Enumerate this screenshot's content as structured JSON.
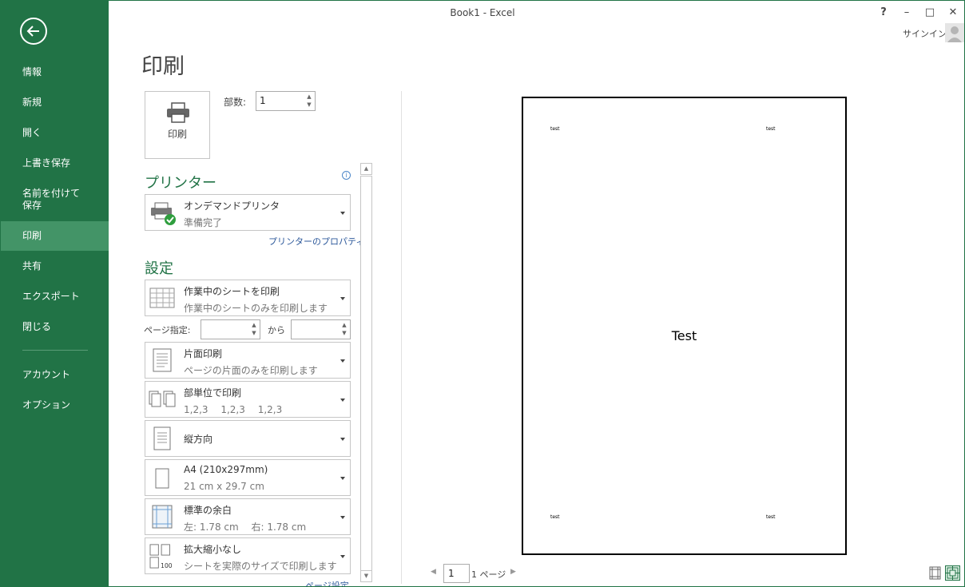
{
  "window": {
    "title": "Book1 - Excel",
    "help": "?",
    "minimize": "–",
    "maximize": "□",
    "close": "✕",
    "signin": "サインイン"
  },
  "sidebar": {
    "items": [
      {
        "label": "情報"
      },
      {
        "label": "新規"
      },
      {
        "label": "開く"
      },
      {
        "label": "上書き保存"
      },
      {
        "label": "名前を付けて保存"
      },
      {
        "label": "印刷",
        "active": true
      },
      {
        "label": "共有"
      },
      {
        "label": "エクスポート"
      },
      {
        "label": "閉じる"
      },
      {
        "label": "アカウント"
      },
      {
        "label": "オプション"
      }
    ]
  },
  "page": {
    "title": "印刷",
    "print_button": "印刷",
    "copies_label": "部数:",
    "copies_value": "1"
  },
  "printer": {
    "heading": "プリンター",
    "name": "オンデマンドプリンタ",
    "status": "準備完了",
    "properties_link": "プリンターのプロパティ"
  },
  "settings": {
    "heading": "設定",
    "what": {
      "main": "作業中のシートを印刷",
      "sub": "作業中のシートのみを印刷します"
    },
    "pages_label": "ページ指定:",
    "to_label": "から",
    "sides": {
      "main": "片面印刷",
      "sub": "ページの片面のみを印刷します"
    },
    "collate": {
      "main": "部単位で印刷",
      "sub": "1,2,3　 1,2,3　 1,2,3"
    },
    "orientation": {
      "main": "縦方向"
    },
    "paper": {
      "main": "A4 (210x297mm)",
      "sub": "21 cm x 29.7 cm"
    },
    "margins": {
      "main": "標準の余白",
      "sub": "左:  1.78 cm　 右:  1.78 cm"
    },
    "scaling": {
      "main": "拡大縮小なし",
      "sub": "シートを実際のサイズで印刷します"
    },
    "page_setup_link": "ページ設定"
  },
  "preview": {
    "header_left": "test",
    "header_right": "test",
    "footer_left": "test",
    "footer_right": "test",
    "body_text": "Test",
    "current_page": "1",
    "total_pages": "1 ページ"
  }
}
